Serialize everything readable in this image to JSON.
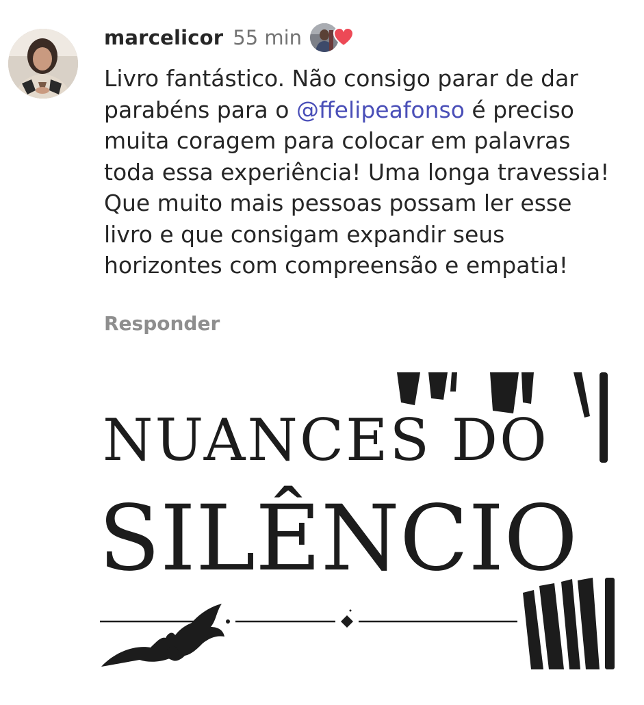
{
  "comment": {
    "username": "marcelicor",
    "timestamp": "55 min",
    "text_before_mention": "Livro fantástico. Não consigo parar de dar parabéns para o ",
    "mention": "@ffelipeafonso",
    "text_after_mention": " é preciso muita coragem para colocar em palavras toda essa experiência! Uma longa travessia! Que muito mais pessoas possam ler esse livro e que consigam expandir seus horizontes com compreensão e empatia!",
    "reply_label": "Responder",
    "liked_by_author": true
  },
  "book_cover": {
    "title_line_1": "NUANCES DO",
    "title_line_2": "SILÊNCIO"
  },
  "colors": {
    "mention": "#4a4fb8",
    "heart": "#ed4956",
    "secondary_text": "#8e8e8e",
    "cover_ink": "#1c1c1c"
  },
  "icons": {
    "heart": "heart-icon",
    "bat": "bat-icon"
  }
}
